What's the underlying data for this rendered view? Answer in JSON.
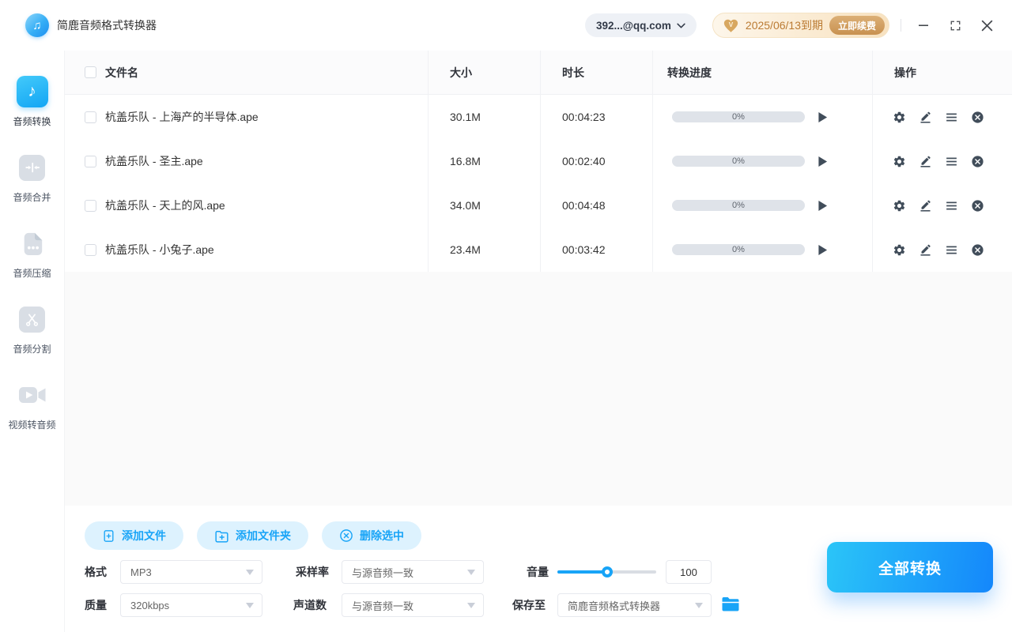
{
  "app": {
    "title": "简鹿音频格式转换器"
  },
  "topbar": {
    "account": "392...@qq.com",
    "vip": {
      "expiry": "2025/06/13到期",
      "renew": "立即续费"
    }
  },
  "sidebar": {
    "items": [
      {
        "label": "音频转换",
        "icon": "music-note-icon",
        "active": true
      },
      {
        "label": "音频合并",
        "icon": "merge-icon",
        "active": false
      },
      {
        "label": "音频压缩",
        "icon": "compress-file-icon",
        "active": false
      },
      {
        "label": "音频分割",
        "icon": "scissors-icon",
        "active": false
      },
      {
        "label": "视频转音频",
        "icon": "video-camera-icon",
        "active": false
      }
    ]
  },
  "table": {
    "headers": {
      "name": "文件名",
      "size": "大小",
      "duration": "时长",
      "progress": "转换进度",
      "actions": "操作"
    },
    "rows": [
      {
        "name": "杭盖乐队 - 上海产的半导体.ape",
        "size": "30.1M",
        "duration": "00:04:23",
        "progress_label": "0%",
        "progress_value": 0
      },
      {
        "name": "杭盖乐队 - 圣主.ape",
        "size": "16.8M",
        "duration": "00:02:40",
        "progress_label": "0%",
        "progress_value": 0
      },
      {
        "name": "杭盖乐队 - 天上的风.ape",
        "size": "34.0M",
        "duration": "00:04:48",
        "progress_label": "0%",
        "progress_value": 0
      },
      {
        "name": "杭盖乐队 - 小兔子.ape",
        "size": "23.4M",
        "duration": "00:03:42",
        "progress_label": "0%",
        "progress_value": 0
      }
    ]
  },
  "footer": {
    "add_file": "添加文件",
    "add_folder": "添加文件夹",
    "delete_selected": "删除选中",
    "format": {
      "label": "格式",
      "value": "MP3"
    },
    "sample_rate": {
      "label": "采样率",
      "value": "与源音频一致"
    },
    "volume": {
      "label": "音量",
      "value": "100"
    },
    "quality": {
      "label": "质量",
      "value": "320kbps"
    },
    "channels": {
      "label": "声道数",
      "value": "与源音频一致"
    },
    "save_to": {
      "label": "保存至",
      "value": "简鹿音频格式转换器"
    },
    "convert_all": "全部转换"
  },
  "colors": {
    "primary": "#18a4f7",
    "convert_gradient": [
      "#2bc5f8",
      "#1487fb"
    ],
    "vip_text": "#bb7b33",
    "vip_badge_bg": [
      "#fdf6ea",
      "#f8e2c0"
    ],
    "renew_bg": [
      "#dcb077",
      "#c89150"
    ],
    "progress_track": "#dfe3e9",
    "pill_button_bg": "#ddf2fe",
    "icon_gray": "#d9dee5",
    "action_icon": "#414d5a"
  }
}
